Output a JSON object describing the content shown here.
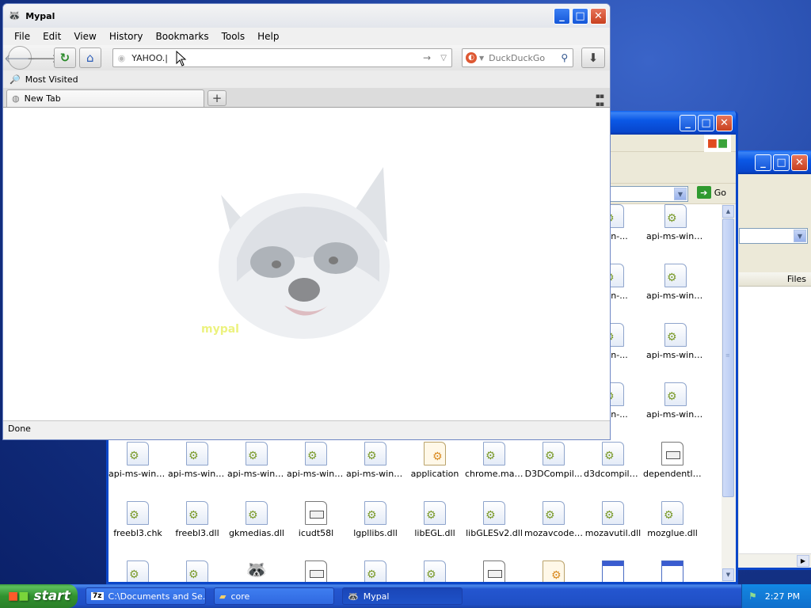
{
  "browser": {
    "title": "Mypal",
    "menu": [
      "File",
      "Edit",
      "View",
      "History",
      "Bookmarks",
      "Tools",
      "Help"
    ],
    "url_value": "YAHOO.|",
    "search_placeholder": "DuckDuckGo",
    "bookmarks_item": "Most Visited",
    "tab_label": "New Tab",
    "new_tab_symbol": "+",
    "status": "Done",
    "logo_text": "mypal"
  },
  "explorer": {
    "go_label": "Go",
    "files_column": "Files",
    "files": [
      {
        "name": "api-ms-win-...",
        "type": "dll"
      },
      {
        "name": "api-ms-win-...",
        "type": "dll"
      },
      {
        "name": "api-ms-win-...",
        "type": "dll"
      },
      {
        "name": "api-ms-win-...",
        "type": "dll"
      },
      {
        "name": "api-ms-win-...",
        "type": "dll"
      },
      {
        "name": "application",
        "type": "app"
      },
      {
        "name": "chrome.man...",
        "type": "dll"
      },
      {
        "name": "D3DCompil...",
        "type": "dll"
      },
      {
        "name": "d3dcompiler...",
        "type": "dll"
      },
      {
        "name": "dependentli...",
        "type": "txt"
      },
      {
        "name": "freebl3.chk",
        "type": "dll"
      },
      {
        "name": "freebl3.dll",
        "type": "dll"
      },
      {
        "name": "gkmedias.dll",
        "type": "dll"
      },
      {
        "name": "icudt58l",
        "type": "txt"
      },
      {
        "name": "lgpllibs.dll",
        "type": "dll"
      },
      {
        "name": "libEGL.dll",
        "type": "dll"
      },
      {
        "name": "libGLESv2.dll",
        "type": "dll"
      },
      {
        "name": "mozavcodec...",
        "type": "dll"
      },
      {
        "name": "mozavutil.dll",
        "type": "dll"
      },
      {
        "name": "mozglue.dll",
        "type": "dll"
      }
    ],
    "side_files": [
      "-win-...",
      "api-ms-win-...",
      "-win-...",
      "api-ms-win-...",
      "-win-...",
      "api-ms-win-...",
      "-win-...",
      "api-ms-win-..."
    ]
  },
  "taskbar": {
    "start_label": "start",
    "tasks": [
      "C:\\Documents and Se...",
      "core",
      "Mypal"
    ],
    "clock": "2:27 PM"
  },
  "colors": {
    "xp_blue": "#0a58e6",
    "start_green": "#31922f",
    "tray_blue": "#0f6fcc"
  }
}
